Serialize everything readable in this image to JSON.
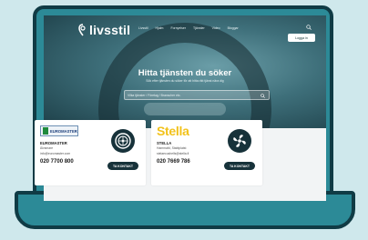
{
  "brand": {
    "name": "livsstil"
  },
  "nav": {
    "links": [
      "Livsstil",
      "Hjalm",
      "Fornyelser",
      "Tjänster",
      "Video",
      "Bloggar"
    ],
    "login_label": "Logga in"
  },
  "hero": {
    "title": "Hitta tjänsten du söker",
    "subtitle": "Sök efter tjänsten du söker för att hitta rätt tjänst nära dig",
    "search_placeholder": "Vilka tjänster / Företag / Branscher etc."
  },
  "cards": [
    {
      "logo_text": "EUROMASTER",
      "name": "EUROMASTER",
      "city": "Älvsmare",
      "email": "info@euromaster.com",
      "phone": "020 7700 800",
      "button": "TA KONTAKT",
      "icon": "tire-icon"
    },
    {
      "logo_text": "Stella",
      "name": "STELLA",
      "city": "Hammafd, Stablplatst",
      "email": "stelaecushells@stella.fi",
      "phone": "020 7669 786",
      "button": "TA KONTAKT",
      "icon": "fan-icon"
    }
  ],
  "colors": {
    "laptop": "#2c8a97",
    "outline": "#103b45",
    "background": "#cfe8ec",
    "accent_dark": "#17323a",
    "stella_yellow": "#f2c21b"
  }
}
